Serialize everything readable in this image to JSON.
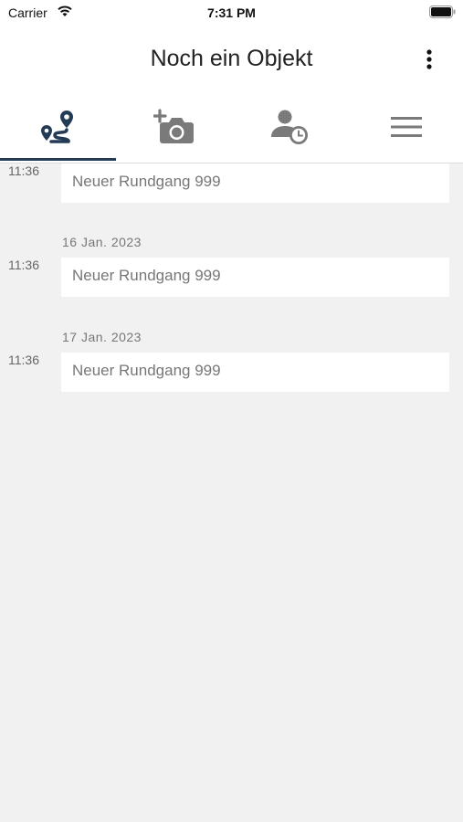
{
  "status_bar": {
    "carrier": "Carrier",
    "time": "7:31 PM"
  },
  "nav": {
    "title": "Noch ein Objekt"
  },
  "tabs": [
    {
      "icon": "route-icon",
      "active": true
    },
    {
      "icon": "add-photo-icon",
      "active": false
    },
    {
      "icon": "person-clock-icon",
      "active": false
    },
    {
      "icon": "menu-icon",
      "active": false
    }
  ],
  "entries": [
    {
      "date": "",
      "time": "11:36",
      "title": "Neuer Rundgang 999"
    },
    {
      "date": "16 Jan. 2023",
      "time": "11:36",
      "title": "Neuer Rundgang 999"
    },
    {
      "date": "17 Jan. 2023",
      "time": "11:36",
      "title": "Neuer Rundgang 999"
    }
  ],
  "colors": {
    "accent": "#243b55",
    "icon_gray": "#7a7a7a",
    "background": "#f1f1f1"
  }
}
